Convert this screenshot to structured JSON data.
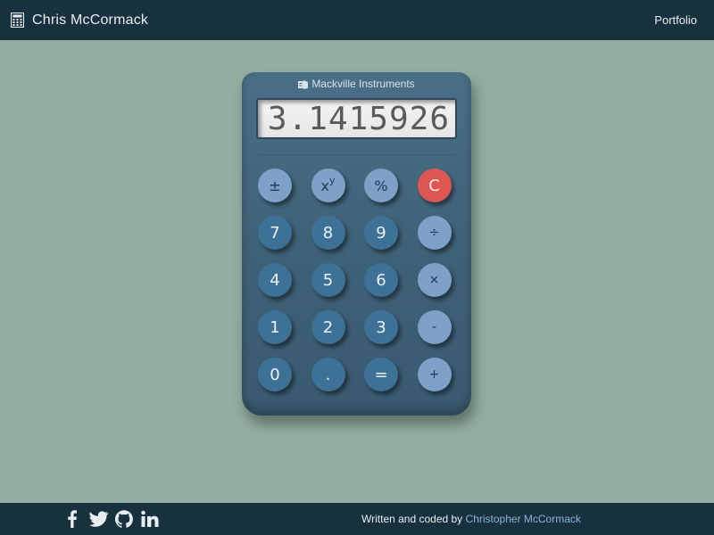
{
  "navbar": {
    "brand_icon": "calculator-icon",
    "brand": "Chris McCormack",
    "link": "Portfolio"
  },
  "calculator": {
    "maker_icon": "calculator-logo-icon",
    "maker": "Mackville Instruments",
    "display": "3.1415926",
    "keys": [
      {
        "label": "±",
        "type": "fn"
      },
      {
        "label": "x",
        "sup": "y",
        "type": "fn"
      },
      {
        "label": "%",
        "type": "fn"
      },
      {
        "label": "C",
        "type": "clear"
      },
      {
        "label": "7",
        "type": "num"
      },
      {
        "label": "8",
        "type": "num"
      },
      {
        "label": "9",
        "type": "num"
      },
      {
        "label": "÷",
        "type": "op"
      },
      {
        "label": "4",
        "type": "num"
      },
      {
        "label": "5",
        "type": "num"
      },
      {
        "label": "6",
        "type": "num"
      },
      {
        "label": "×",
        "type": "op"
      },
      {
        "label": "1",
        "type": "num"
      },
      {
        "label": "2",
        "type": "num"
      },
      {
        "label": "3",
        "type": "num"
      },
      {
        "label": "-",
        "type": "op"
      },
      {
        "label": "0",
        "type": "num"
      },
      {
        "label": ".",
        "type": "num"
      },
      {
        "label": "=",
        "type": "num"
      },
      {
        "label": "+",
        "type": "op"
      }
    ]
  },
  "footer": {
    "social": [
      "facebook-icon",
      "twitter-icon",
      "github-icon",
      "linkedin-icon"
    ],
    "credit_prefix": "Written and coded by",
    "credit_name": "Christopher McCormack"
  },
  "colors": {
    "background": "#93ae9f",
    "bar": "#17313f",
    "calc_body": "#42667d",
    "key_num": "#3e7196",
    "key_fn": "#7da1c9",
    "key_clear": "#dc5653",
    "link": "#8cb4d8"
  }
}
